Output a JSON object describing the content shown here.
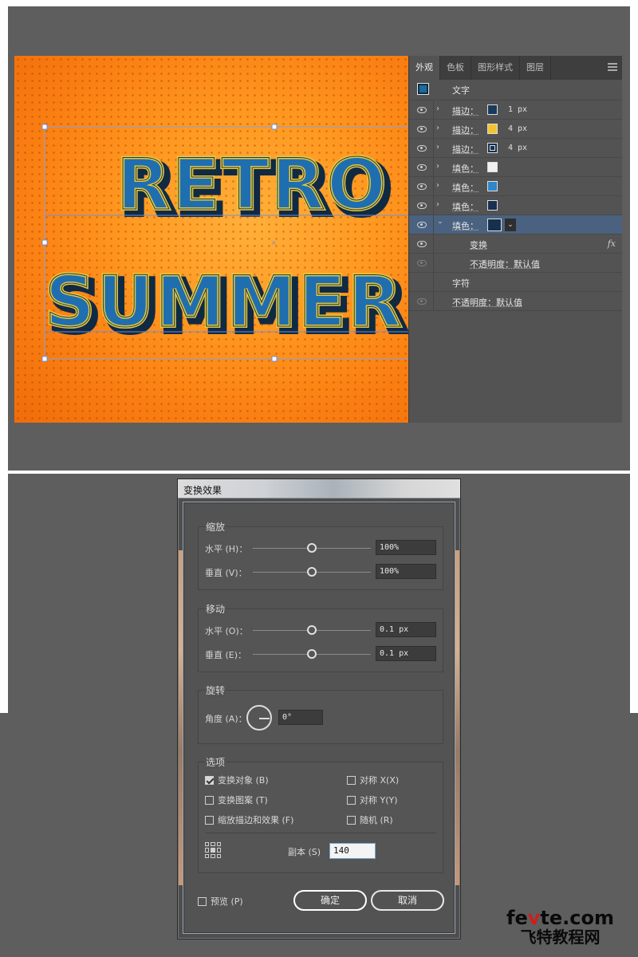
{
  "artwork": {
    "line1": "RETRO",
    "line2": "SUMMER",
    "colors": {
      "bg_center": "#ffb03a",
      "bg_edge": "#f06c0a",
      "text_fill": "#1f6fb0",
      "text_stroke": "#e8c73a",
      "text_shadow": "#102a44"
    }
  },
  "appearance_panel": {
    "tabs": [
      "外观",
      "色板",
      "图形样式",
      "图层"
    ],
    "active_tab": "外观",
    "header_label": "文字",
    "rows": [
      {
        "label": "描边：",
        "swatch": "#1a3a5a",
        "value": "1 px"
      },
      {
        "label": "描边：",
        "swatch": "#f2c530",
        "value": "4 px"
      },
      {
        "label": "描边：",
        "swatch": "#15324d",
        "value": "4 px"
      },
      {
        "label": "填色：",
        "swatch": "#f0f0f0",
        "value": ""
      },
      {
        "label": "填色：",
        "swatch": "#2f86c8",
        "value": ""
      },
      {
        "label": "填色：",
        "swatch": "#1a3050",
        "value": ""
      },
      {
        "label": "填色：",
        "swatch": "#16304e",
        "value": ""
      }
    ],
    "effect_label": "变换",
    "fx_label": "fx",
    "sub_opacity": "不透明度：默认值",
    "char_label": "字符",
    "char_opacity": "不透明度：默认值"
  },
  "dialog": {
    "title": "变换效果",
    "scale": {
      "title": "缩放",
      "horizontal_label": "水平 (H)：",
      "horizontal_value": "100%",
      "vertical_label": "垂直 (V)：",
      "vertical_value": "100%"
    },
    "move": {
      "title": "移动",
      "horizontal_label": "水平 (O)：",
      "horizontal_value": "0.1 px",
      "vertical_label": "垂直 (E)：",
      "vertical_value": "0.1 px"
    },
    "rotate": {
      "title": "旋转",
      "angle_label": "角度 (A)：",
      "angle_value": "0°"
    },
    "options": {
      "title": "选项",
      "transform_objects": "变换对象 (B)",
      "transform_objects_checked": true,
      "transform_patterns": "变换图案 (T)",
      "scale_strokes": "缩放描边和效果 (F)",
      "reflect_x": "对称 X(X)",
      "reflect_y": "对称 Y(Y)",
      "random": "随机 (R)",
      "copies_label": "副本 (S)",
      "copies_value": "140"
    },
    "preview": "预览 (P)",
    "ok": "确定",
    "cancel": "取消"
  },
  "watermark": {
    "line1_a": "fe",
    "line1_b": "v",
    "line1_c": "te.com",
    "line2": "飞特教程网"
  }
}
